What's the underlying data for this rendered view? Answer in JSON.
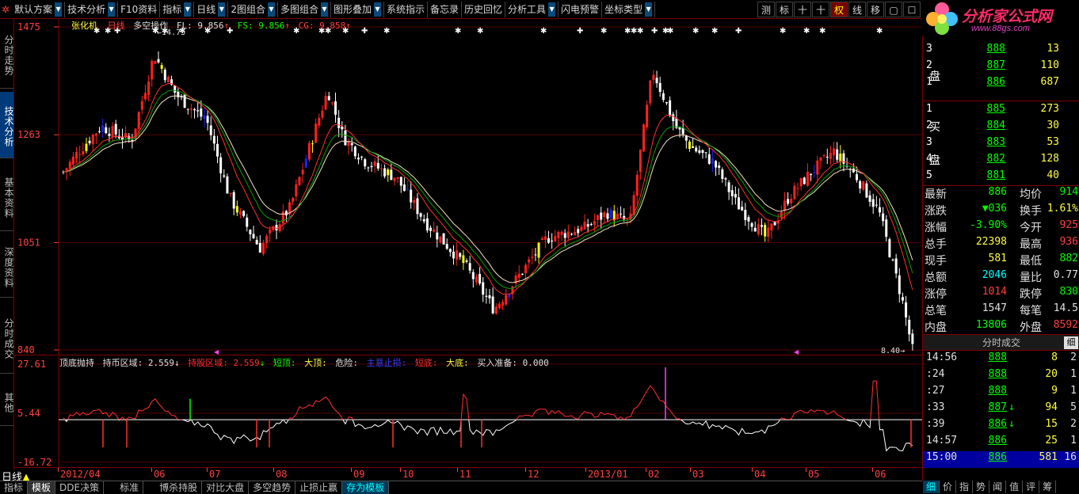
{
  "toolbar": {
    "items": [
      {
        "label": "默认方案",
        "dropdown": true
      },
      {
        "label": "技术分析",
        "dropdown": true
      },
      {
        "label": "F10资料",
        "dropdown": false
      },
      {
        "label": "指标",
        "dropdown": true
      },
      {
        "label": "日线",
        "dropdown": true
      },
      {
        "label": "2图组合",
        "dropdown": true
      },
      {
        "label": "多图组合",
        "dropdown": true
      },
      {
        "label": "图形叠加",
        "dropdown": true
      },
      {
        "label": "系统指示",
        "dropdown": false
      },
      {
        "label": "备忘录",
        "dropdown": false
      },
      {
        "label": "历史回忆",
        "dropdown": false
      },
      {
        "label": "分析工具",
        "dropdown": true
      },
      {
        "label": "闪电预警",
        "dropdown": false
      },
      {
        "label": "坐标类型",
        "dropdown": true
      }
    ],
    "right_buttons": [
      "测",
      "标",
      "十",
      "十",
      "权",
      "线",
      "移",
      "▢",
      "☐"
    ]
  },
  "logo": {
    "text": "分析家公式网",
    "url": "www.88gs.com"
  },
  "left_tabs": [
    "分时走势",
    "技术分析",
    "基本资料",
    "深度资料",
    "分时成交",
    "其他"
  ],
  "main_chart": {
    "stock_name": "张化机",
    "period": "日线",
    "indicator": "多空操作",
    "fl_label": "FL: 9.856",
    "fs_label": "FS: 9.856",
    "cg_label": "CG: 9.858",
    "max_marker": "14.75",
    "min_marker": "8.40",
    "y_ticks": [
      "1475",
      "1263",
      "1051",
      "840"
    ]
  },
  "ind_chart": {
    "title": "顶底抛持",
    "label_hold": "持币区域:",
    "val_hold": "2.559",
    "label_holdstock": "持股区域:",
    "val_holdstock": "2.559",
    "label_short_top": "短顶:",
    "label_big_top": "大顶:",
    "label_danger": "危险:",
    "label_main_out": "主意止损:",
    "label_short_bottom": "短底:",
    "label_big_bottom": "大底:",
    "label_buy_ready": "买入准备:",
    "val_buy_ready": "0.000",
    "y_ticks": [
      "27.61",
      "5.44",
      "-16.72"
    ]
  },
  "date_axis": {
    "ticks": [
      "2012/04",
      "06",
      "07",
      "08",
      "09",
      "10",
      "11",
      "12",
      "2013/01",
      "02",
      "03",
      "04",
      "05",
      "06"
    ],
    "period_label": "日线"
  },
  "bottom_tabs": [
    "指标",
    "模板",
    "DDE决策",
    "标准",
    "博杀持股",
    "对比大盘",
    "多空趋势",
    "止损止赢",
    "存为模板"
  ],
  "order_book": {
    "sell_side_label": [
      "卖",
      "盘"
    ],
    "buy_side_label": [
      "买",
      "盘"
    ],
    "sell": [
      {
        "level": "3",
        "price": "888",
        "volume": "13"
      },
      {
        "level": "2",
        "price": "887",
        "volume": "110"
      },
      {
        "level": "1",
        "price": "886",
        "volume": "687"
      }
    ],
    "buy": [
      {
        "level": "1",
        "price": "885",
        "volume": "273"
      },
      {
        "level": "2",
        "price": "884",
        "volume": "30"
      },
      {
        "level": "3",
        "price": "883",
        "volume": "53"
      },
      {
        "level": "4",
        "price": "882",
        "volume": "128"
      },
      {
        "level": "5",
        "price": "881",
        "volume": "40"
      }
    ]
  },
  "stats": [
    {
      "k1": "最新",
      "v1": "886",
      "c1": "#00ff00",
      "k2": "均价",
      "v2": "914",
      "c2": "#00ff00"
    },
    {
      "k1": "涨跌",
      "v1": "▼036",
      "c1": "#00ff00",
      "k2": "换手",
      "v2": "1.61%",
      "c2": "#ffff40"
    },
    {
      "k1": "涨幅",
      "v1": "-3.90%",
      "c1": "#00ff00",
      "k2": "今开",
      "v2": "925",
      "c2": "#ff4040"
    },
    {
      "k1": "总手",
      "v1": "22398",
      "c1": "#ffff40",
      "k2": "最高",
      "v2": "936",
      "c2": "#ff4040"
    },
    {
      "k1": "现手",
      "v1": "581",
      "c1": "#ffff40",
      "k2": "最低",
      "v2": "882",
      "c2": "#00ff00"
    },
    {
      "k1": "总额",
      "v1": "2046",
      "c1": "#00ffff",
      "k2": "量比",
      "v2": "0.77",
      "c2": "#e0e0e0"
    },
    {
      "k1": "涨停",
      "v1": "1014",
      "c1": "#ff4040",
      "k2": "跌停",
      "v2": "830",
      "c2": "#00ff00"
    },
    {
      "k1": "总笔",
      "v1": "1547",
      "c1": "#e0e0e0",
      "k2": "每笔",
      "v2": "14.5",
      "c2": "#e0e0e0"
    },
    {
      "k1": "内盘",
      "v1": "13806",
      "c1": "#00ff00",
      "k2": "外盘",
      "v2": "8592",
      "c2": "#ff4040"
    }
  ],
  "trades": {
    "title": "分时成交",
    "mini_label": "细",
    "rows": [
      {
        "time": "14:56",
        "price": "888",
        "arrow": "",
        "vol": "8",
        "num": "2"
      },
      {
        "time": ":24",
        "price": "888",
        "arrow": "",
        "vol": "20",
        "num": "1"
      },
      {
        "time": ":27",
        "price": "888",
        "arrow": "",
        "vol": "9",
        "num": "1"
      },
      {
        "time": ":33",
        "price": "887",
        "arrow": "↓",
        "vol": "94",
        "num": "5"
      },
      {
        "time": ":39",
        "price": "886",
        "arrow": "↓",
        "vol": "15",
        "num": "2"
      },
      {
        "time": "14:57",
        "price": "886",
        "arrow": "",
        "vol": "25",
        "num": "1"
      },
      {
        "time": "15:00",
        "price": "886",
        "arrow": "",
        "vol": "581",
        "num": "16"
      }
    ]
  },
  "right_tabs": [
    "细",
    "价",
    "指",
    "势",
    "闻",
    "值",
    "评",
    "筹"
  ],
  "colors": {
    "up": "#ff2020",
    "down": "#ffffff",
    "special_blue": "#2020ff",
    "special_yellow": "#ffff00",
    "ma1": "#ff3030",
    "ma2": "#00a000",
    "ma3": "#f0e0c0",
    "grid": "#600000"
  }
}
